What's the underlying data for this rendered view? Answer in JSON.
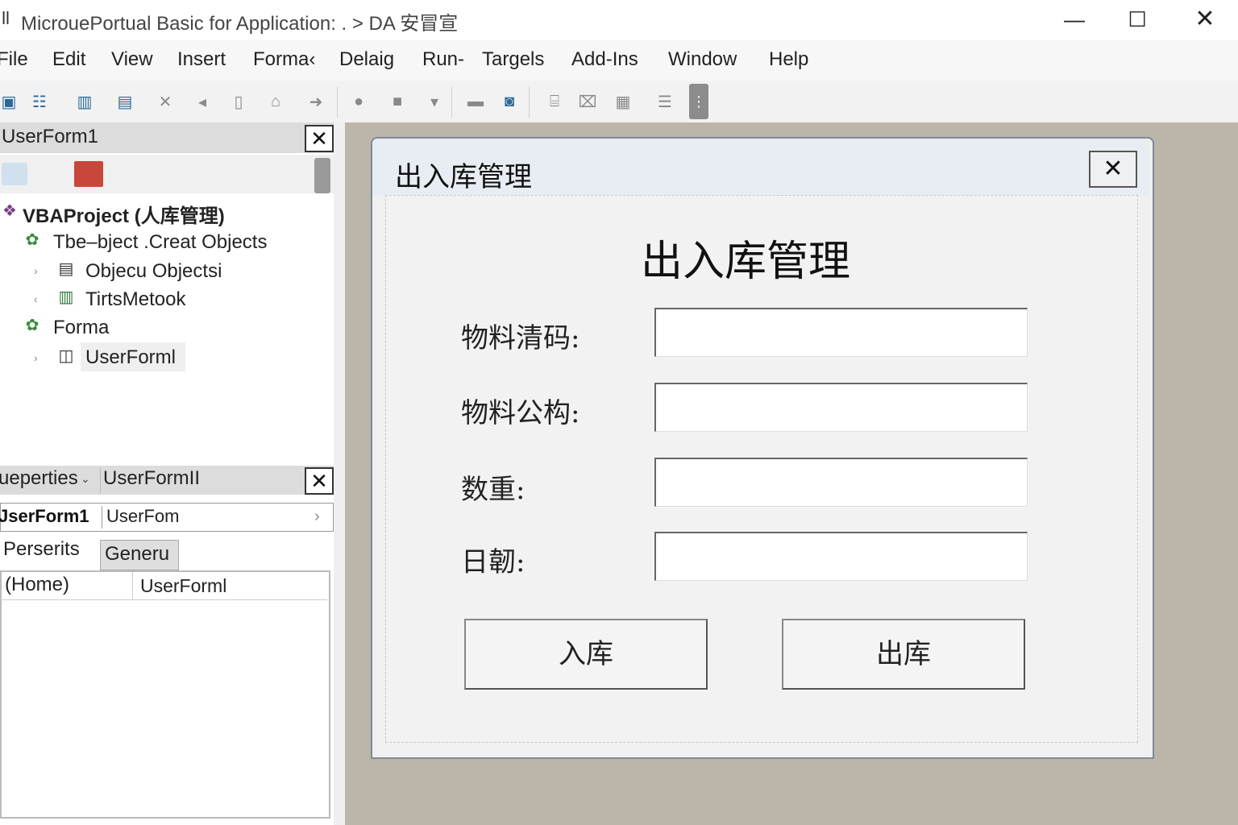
{
  "window": {
    "title": "MicrouePortual Basic for Application: . > DA 安冒宣",
    "app_icon": "vba-app-icon",
    "controls": {
      "minimize": "—",
      "maximize": "☐",
      "close": "✕"
    }
  },
  "menu": [
    {
      "key": "file",
      "label": "File"
    },
    {
      "key": "edit",
      "label": "Edit"
    },
    {
      "key": "view",
      "label": "View"
    },
    {
      "key": "insert",
      "label": "Insert"
    },
    {
      "key": "format",
      "label": "Forma‹"
    },
    {
      "key": "debug",
      "label": "Delaig"
    },
    {
      "key": "run",
      "label": "Run-"
    },
    {
      "key": "tools",
      "label": "Targels"
    },
    {
      "key": "addins",
      "label": "Add-Ins"
    },
    {
      "key": "window",
      "label": "Window"
    },
    {
      "key": "help",
      "label": "Help"
    }
  ],
  "toolbar": {
    "icons": [
      "view-excel-icon",
      "insert-userform-icon",
      "save-icon",
      "save-as-icon",
      "cut-icon",
      "undo-icon",
      "copy-icon",
      "paste-icon",
      "redo-icon",
      "run-icon",
      "break-icon",
      "reset-icon",
      "design-mode-icon",
      "project-explorer-icon",
      "properties-icon",
      "object-browser-icon",
      "toolbox-icon",
      "align-icon"
    ]
  },
  "project_explorer": {
    "title": "UserForm1",
    "close": "✕",
    "root": "VBAProject (人库管理)",
    "nodes": [
      {
        "label": "Tbe–bject .Creat Objects"
      },
      {
        "label": "Objecu Objectsi"
      },
      {
        "label": "TirtsMetook"
      },
      {
        "label": "Forma"
      },
      {
        "label": "UserForml"
      }
    ]
  },
  "properties": {
    "title": "ueperties",
    "form_name": "UserFormII",
    "close": "✕",
    "object_name": "JserForm1",
    "object_type": "UserFom",
    "object_arrow": "›",
    "tab_alpha": "Perserits",
    "tab_categorized": "Generu",
    "rows": [
      {
        "name": "(Home)",
        "value": "UserForml"
      }
    ]
  },
  "userform": {
    "window_title": "出入库管理",
    "close": "✕",
    "heading": "出入库管理",
    "fields": [
      {
        "label": "物料清码:",
        "value": ""
      },
      {
        "label": "物料公构:",
        "value": ""
      },
      {
        "label": "数重:",
        "value": ""
      },
      {
        "label": "日韌:",
        "value": ""
      }
    ],
    "buttons": {
      "in": "入库",
      "out": "出库"
    }
  }
}
